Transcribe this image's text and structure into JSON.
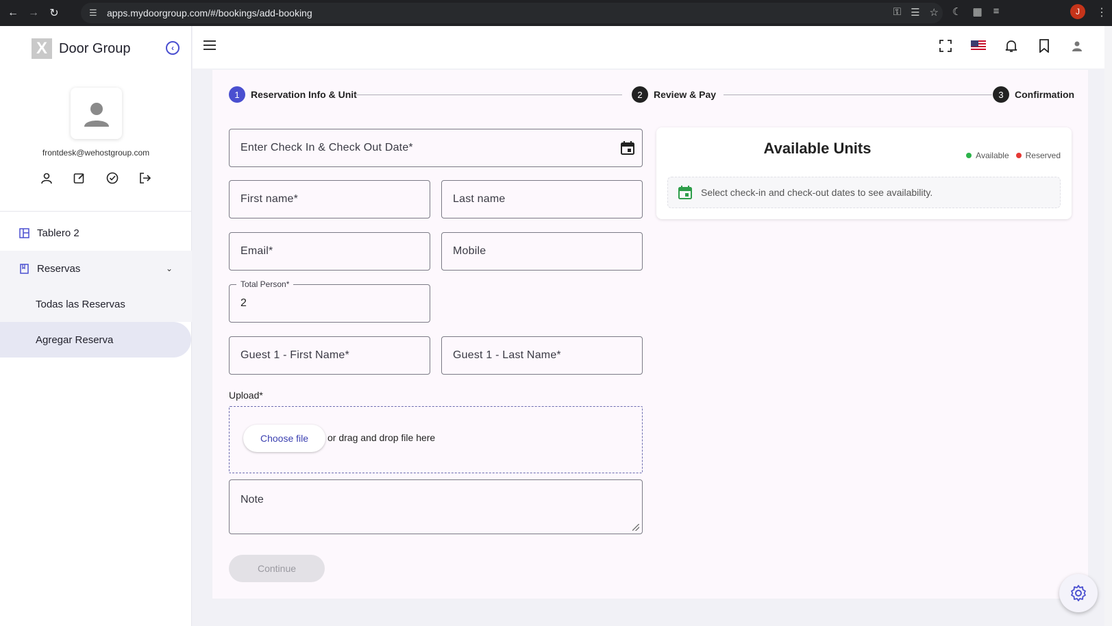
{
  "browser": {
    "url": "apps.mydoorgroup.com/#/bookings/add-booking",
    "profile_initial": "J"
  },
  "sidebar": {
    "brand": "Door Group",
    "logo_letter": "X",
    "user_email": "frontdesk@wehostgroup.com",
    "items": [
      {
        "label": "Tablero 2"
      },
      {
        "label": "Reservas"
      },
      {
        "label": "Todas las Reservas"
      },
      {
        "label": "Agregar Reserva"
      }
    ]
  },
  "stepper": {
    "steps": [
      {
        "num": "1",
        "label": "Reservation Info & Unit"
      },
      {
        "num": "2",
        "label": "Review & Pay"
      },
      {
        "num": "3",
        "label": "Confirmation"
      }
    ]
  },
  "form": {
    "dates_placeholder": "Enter Check In & Check Out Date*",
    "first_name_placeholder": "First name*",
    "last_name_placeholder": "Last name",
    "email_placeholder": "Email*",
    "mobile_placeholder": "Mobile",
    "total_person_label": "Total Person*",
    "total_person_value": "2",
    "guest_first_placeholder": "Guest 1 - First Name*",
    "guest_last_placeholder": "Guest 1 - Last Name*",
    "upload_label": "Upload*",
    "choose_file": "Choose file",
    "drag_text": "or drag and drop file here",
    "note_placeholder": "Note",
    "continue": "Continue"
  },
  "units": {
    "title": "Available Units",
    "legend_available": "Available",
    "legend_reserved": "Reserved",
    "message": "Select check-in and check-out dates to see availability."
  },
  "colors": {
    "accent": "#4a4fd0",
    "available": "#2bb34a",
    "reserved": "#e53935",
    "calendar_green": "#2e9e4a"
  }
}
